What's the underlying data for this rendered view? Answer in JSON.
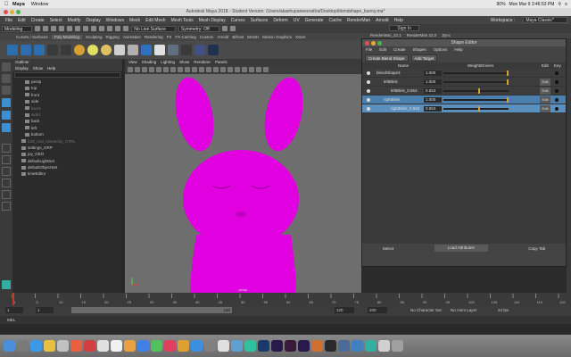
{
  "mac_menubar": {
    "app": "Maya",
    "items": [
      "Window"
    ],
    "status": {
      "battery": "90%",
      "clock": "Mon Mar 9 3:46:53 PM"
    }
  },
  "window_title": "Autodesk Maya 2018 - Student Version: /Users/akashupaneeeratha/Desktop/blendshape_bunny.ma*",
  "maya_menu": [
    "File",
    "Edit",
    "Create",
    "Select",
    "Modify",
    "Display",
    "Windows",
    "Mesh",
    "Edit Mesh",
    "Mesh Tools",
    "Mesh Display",
    "Curves",
    "Surfaces",
    "Deform",
    "UV",
    "Generate",
    "Cache",
    "RenderMan",
    "Arnold",
    "Help"
  ],
  "workspace": {
    "label": "Workspace :",
    "value": "Maya Classic*"
  },
  "status_line": {
    "mode": "Modeling",
    "live_surface": "No Live Surface",
    "symmetry": "Symmetry: Off",
    "sign_in": "Sign In"
  },
  "shelf_tabs": [
    "Curves / Surfaces",
    "Poly Modeling",
    "Sculpting",
    "Rigging",
    "Animation",
    "Rendering",
    "FX",
    "FX Caching",
    "Custom",
    "Arnold",
    "Bifrost",
    "MASH",
    "Motion Graphics",
    "XGen",
    "RenderMan_22.1",
    "RenderMan 22.0",
    "Zync"
  ],
  "outliner": {
    "title": "Outliner",
    "menu": [
      "Display",
      "Show",
      "Help"
    ],
    "items": [
      {
        "label": "persp",
        "dim": false
      },
      {
        "label": "top",
        "dim": false
      },
      {
        "label": "front",
        "dim": false
      },
      {
        "label": "side",
        "dim": false
      },
      {
        "label": "face1",
        "dim": true
      },
      {
        "label": "side1",
        "dim": true
      },
      {
        "label": "back",
        "dim": false
      },
      {
        "label": "left",
        "dim": false
      },
      {
        "label": "bottom",
        "dim": false
      },
      {
        "label": "b3d_root_Hierarchy_CTRL",
        "dim": true
      },
      {
        "label": "settings_GRP",
        "dim": false
      },
      {
        "label": "joy_GEO",
        "dim": false
      },
      {
        "label": "defaultLightSet",
        "dim": false
      },
      {
        "label": "defaultObjectSet",
        "dim": false
      },
      {
        "label": "timeEditor",
        "dim": false
      }
    ]
  },
  "viewport": {
    "menu": [
      "View",
      "Shading",
      "Lighting",
      "Show",
      "Renderer",
      "Panels"
    ],
    "camera_label": "persp",
    "colors": {
      "bg": "#6e6e6e",
      "model": "#e000e0"
    }
  },
  "shape_editor": {
    "title": "Shape Editor",
    "menu": [
      "File",
      "Edit",
      "Create",
      "Shapes",
      "Options",
      "Help"
    ],
    "create_blend_shape": "Create Blend Shape",
    "add_target": "Add Target",
    "columns": {
      "name": "Name",
      "weight": "Weight/Drivers",
      "edit": "Edit",
      "key": "Key"
    },
    "rows": [
      {
        "name": "blendShape3",
        "value": "1.000",
        "indent": 0,
        "highlight": "none",
        "slider": 1.0,
        "edit": ""
      },
      {
        "name": "leftBlink",
        "value": "1.000",
        "indent": 1,
        "highlight": "none",
        "slider": 1.0,
        "edit": "Edit"
      },
      {
        "name": "leftBlink_0.553",
        "value": "0.553",
        "indent": 2,
        "highlight": "none",
        "slider": 0.553,
        "edit": "Edit"
      },
      {
        "name": "rightBlink",
        "value": "1.000",
        "indent": 1,
        "highlight": "hl",
        "slider": 1.0,
        "edit": "Edit"
      },
      {
        "name": "rightBlink_0.553",
        "value": "0.553",
        "indent": 2,
        "highlight": "hl2",
        "slider": 0.553,
        "edit": "Edit"
      }
    ],
    "bottom_buttons": [
      "Select",
      "Load Attributes",
      "Copy Tab"
    ]
  },
  "time_slider": {
    "ticks": [
      "1",
      "5",
      "10",
      "15",
      "20",
      "25",
      "30",
      "35",
      "40",
      "45",
      "50",
      "55",
      "60",
      "65",
      "70",
      "75",
      "80",
      "85",
      "90",
      "95",
      "100",
      "105",
      "110",
      "115",
      "120"
    ],
    "current": "1"
  },
  "range_slider": {
    "start": "1",
    "start2": "1",
    "range_end": "120",
    "end": "120",
    "max": "200",
    "character_set": "No Character Set",
    "anim_layer": "No Anim Layer",
    "fps": "24 fps"
  },
  "mel_label": "MEL"
}
